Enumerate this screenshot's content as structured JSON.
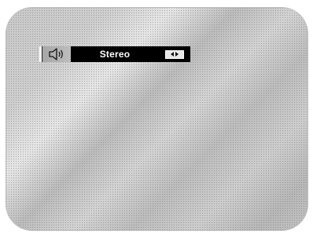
{
  "osd": {
    "icon": "speaker-icon",
    "mode_label": "Stereo",
    "adjust_icon": "left-right-arrows-icon"
  }
}
